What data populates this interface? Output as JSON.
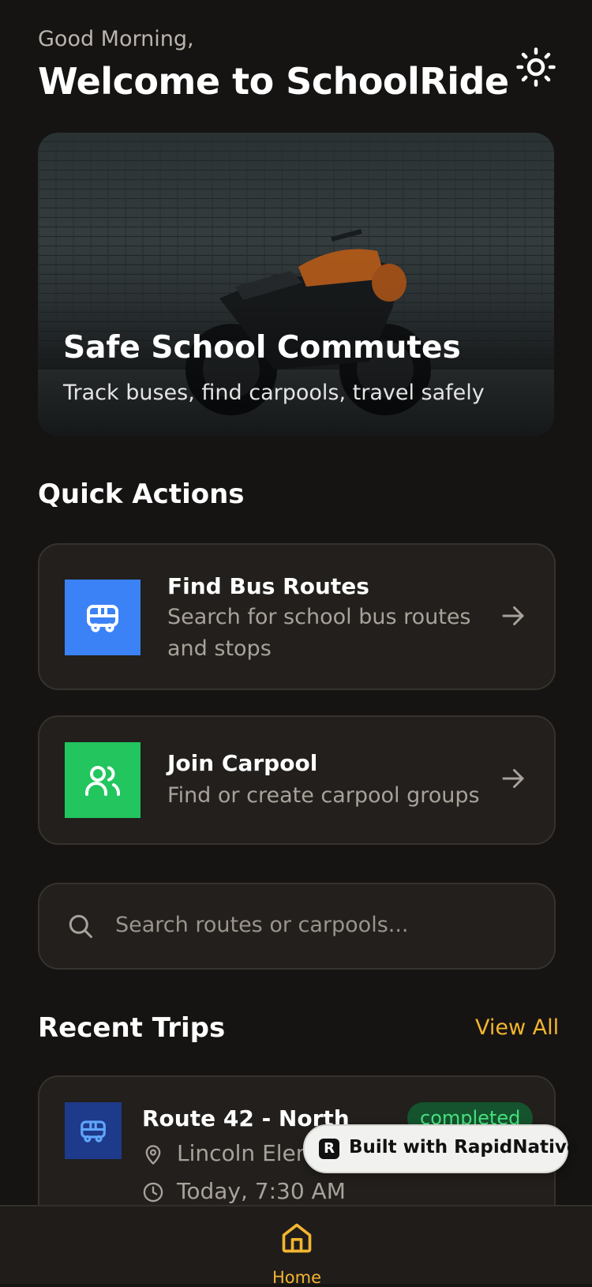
{
  "header": {
    "greeting": "Good Morning,",
    "title": "Welcome to SchoolRide",
    "theme_icon": "sun-icon"
  },
  "hero": {
    "title": "Safe School Commutes",
    "subtitle": "Track buses, find carpools, travel safely"
  },
  "quick_actions": {
    "title": "Quick Actions",
    "items": [
      {
        "title": "Find Bus Routes",
        "subtitle": "Search for school bus routes and stops",
        "icon": "bus-icon",
        "color": "#3b82f6"
      },
      {
        "title": "Join Carpool",
        "subtitle": "Find or create carpool groups",
        "icon": "users-icon",
        "color": "#22c55e"
      }
    ]
  },
  "search": {
    "placeholder": "Search routes or carpools..."
  },
  "recent_trips": {
    "title": "Recent Trips",
    "view_all": "View All",
    "items": [
      {
        "title": "Route 42 - North",
        "status": "completed",
        "location": "Lincoln Elem",
        "time": "Today, 7:30 AM",
        "icon": "bus-icon"
      }
    ]
  },
  "built_badge": {
    "text": "Built with RapidNative"
  },
  "tabbar": {
    "items": [
      {
        "label": "Home",
        "icon": "home-icon",
        "active": true
      }
    ]
  },
  "colors": {
    "background": "#161412",
    "card": "#221f1c",
    "accent": "#f2b531",
    "bus_blue": "#3b82f6",
    "carpool_green": "#22c55e"
  }
}
